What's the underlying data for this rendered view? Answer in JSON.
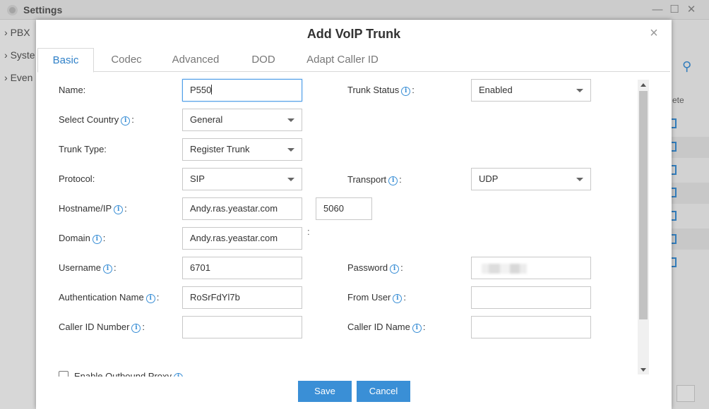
{
  "background": {
    "window_title": "Settings",
    "sidebar_items": [
      "PBX",
      "Syste",
      "Even"
    ],
    "column_header": "ete"
  },
  "dialog": {
    "title": "Add VoIP Trunk",
    "tabs": [
      {
        "label": "Basic",
        "active": true
      },
      {
        "label": "Codec",
        "active": false
      },
      {
        "label": "Advanced",
        "active": false
      },
      {
        "label": "DOD",
        "active": false
      },
      {
        "label": "Adapt Caller ID",
        "active": false
      }
    ],
    "fields": {
      "name": {
        "label": "Name:",
        "value": "P550"
      },
      "trunk_status": {
        "label": "Trunk Status",
        "value": "Enabled"
      },
      "select_country": {
        "label": "Select Country",
        "value": "General"
      },
      "trunk_type": {
        "label": "Trunk Type:",
        "value": "Register Trunk"
      },
      "protocol": {
        "label": "Protocol:",
        "value": "SIP"
      },
      "transport": {
        "label": "Transport",
        "value": "UDP"
      },
      "hostname": {
        "label": "Hostname/IP",
        "value": "Andy.ras.yeastar.com",
        "port": "5060",
        "separator": ":"
      },
      "domain": {
        "label": "Domain",
        "value": "Andy.ras.yeastar.com"
      },
      "username": {
        "label": "Username",
        "value": "6701"
      },
      "password": {
        "label": "Password",
        "value": ""
      },
      "auth_name": {
        "label": "Authentication Name",
        "value": "RoSrFdYl7b"
      },
      "from_user": {
        "label": "From User",
        "value": ""
      },
      "caller_id_number": {
        "label": "Caller ID Number",
        "value": ""
      },
      "caller_id_name": {
        "label": "Caller ID Name",
        "value": ""
      },
      "outbound_proxy": {
        "label": "Enable Outbound Proxy",
        "checked": false
      }
    },
    "buttons": {
      "save": "Save",
      "cancel": "Cancel"
    }
  },
  "colors": {
    "accent": "#3a8fd6",
    "tab_active": "#2f80c8"
  }
}
